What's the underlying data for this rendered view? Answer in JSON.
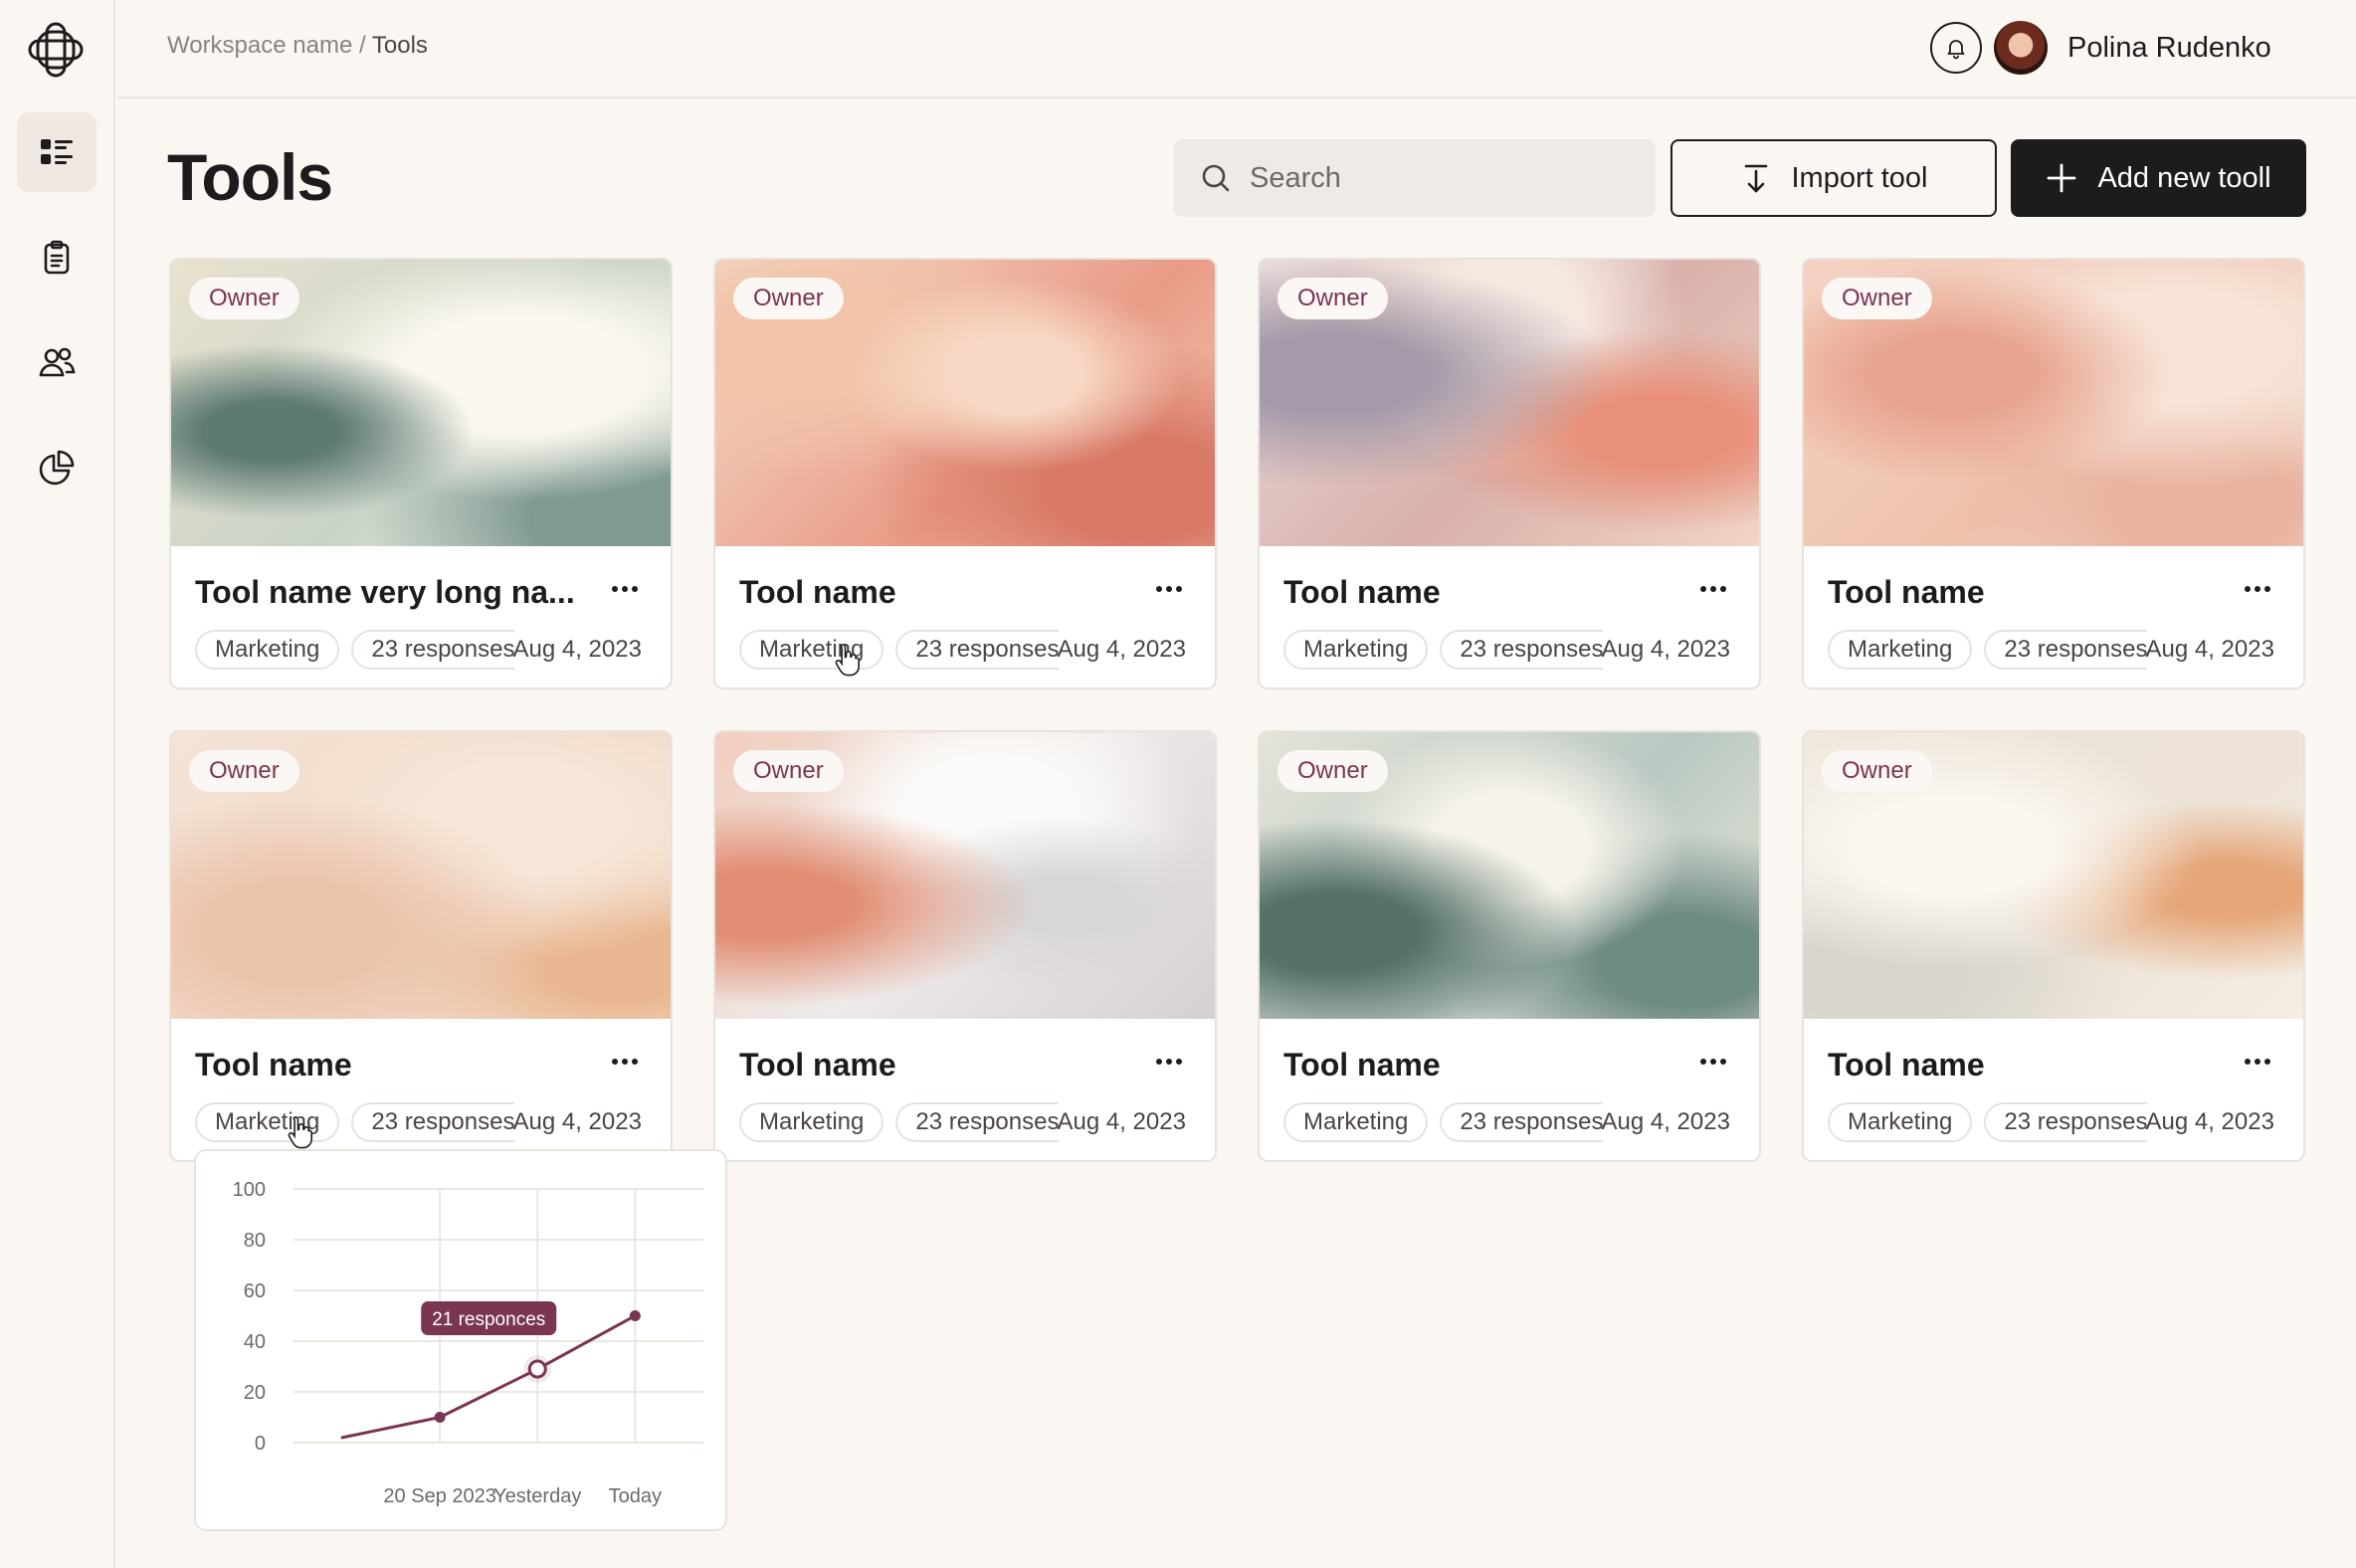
{
  "breadcrumb": {
    "workspace": "Workspace name",
    "separator": "/",
    "current": "Tools"
  },
  "user": {
    "name": "Polina Rudenko"
  },
  "page": {
    "title": "Tools"
  },
  "search": {
    "placeholder": "Search"
  },
  "buttons": {
    "import": "Import tool",
    "add": "Add new tooll"
  },
  "colors": {
    "accent": "#7a3552",
    "dark": "#1e1b1c",
    "chart_line": "#7a3552"
  },
  "cards": [
    {
      "owner": "Owner",
      "name": "Tool name very long na...",
      "tag": "Marketing",
      "responses": "23 responses",
      "date": "Aug 4, 2023"
    },
    {
      "owner": "Owner",
      "name": "Tool name",
      "tag": "Marketing",
      "responses": "23 responses",
      "date": "Aug 4, 2023"
    },
    {
      "owner": "Owner",
      "name": "Tool name",
      "tag": "Marketing",
      "responses": "23 responses",
      "date": "Aug 4, 2023"
    },
    {
      "owner": "Owner",
      "name": "Tool name",
      "tag": "Marketing",
      "responses": "23 responses",
      "date": "Aug 4, 2023"
    },
    {
      "owner": "Owner",
      "name": "Tool name",
      "tag": "Marketing",
      "responses": "23 responses",
      "date": "Aug 4, 2023"
    },
    {
      "owner": "Owner",
      "name": "Tool name",
      "tag": "Marketing",
      "responses": "23 responses",
      "date": "Aug 4, 2023"
    },
    {
      "owner": "Owner",
      "name": "Tool name",
      "tag": "Marketing",
      "responses": "23 responses",
      "date": "Aug 4, 2023"
    },
    {
      "owner": "Owner",
      "name": "Tool name",
      "tag": "Marketing",
      "responses": "23 responses",
      "date": "Aug 4, 2023"
    }
  ],
  "chart_data": {
    "type": "line",
    "x": [
      0,
      1,
      2,
      3
    ],
    "y": [
      2,
      10,
      29,
      50
    ],
    "xticks": [
      {
        "pos": 1,
        "label": "20 Sep 2023"
      },
      {
        "pos": 2,
        "label": "Yesterday"
      },
      {
        "pos": 3,
        "label": "Today"
      }
    ],
    "yticks": [
      0,
      20,
      40,
      60,
      80,
      100
    ],
    "ylim": [
      0,
      100
    ],
    "xlim": [
      -0.5,
      3.7
    ],
    "markers": [
      1,
      3
    ],
    "highlight": {
      "index": 2,
      "label": "21 responces"
    },
    "grid": true
  }
}
